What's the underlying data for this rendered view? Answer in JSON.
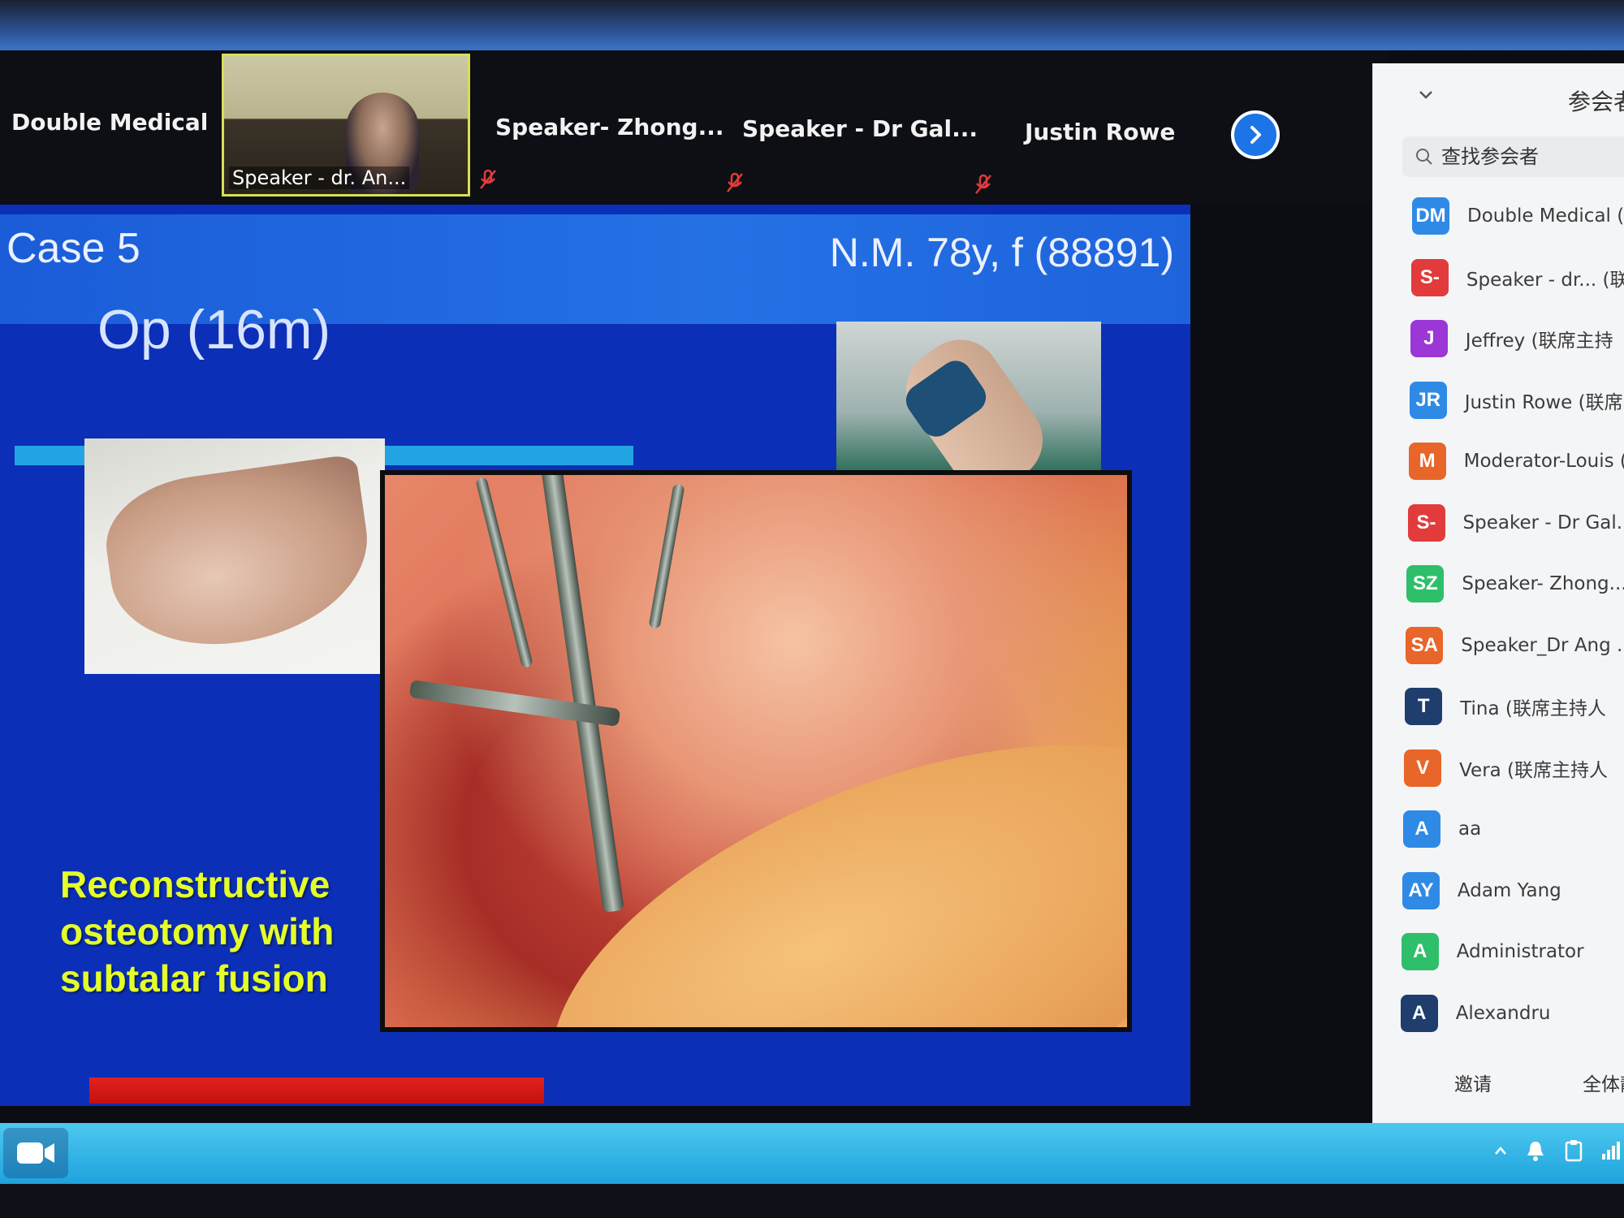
{
  "thumbnails": {
    "tiles": [
      {
        "label": "Double Medical"
      },
      {
        "label": "Speaker - dr. An..."
      },
      {
        "label": "Speaker-  Zhong..."
      },
      {
        "label": "Speaker  -  Dr Gal..."
      },
      {
        "label": "Justin Rowe"
      }
    ]
  },
  "slide": {
    "case_title": "Case 5",
    "patient_id": "N.M. 78y, f (88891)",
    "op_title": "Op (16m)",
    "caption_lines": [
      "Reconstructive",
      "osteotomy with",
      "subtalar fusion"
    ]
  },
  "panel": {
    "title": "参会者",
    "search_placeholder": "查找参会者",
    "participants": [
      {
        "initials": "DM",
        "name": "Double Medical (",
        "color": "#2f8ae6"
      },
      {
        "initials": "S-",
        "name": "Speaker - dr... (联",
        "color": "#e23b3b"
      },
      {
        "initials": "J",
        "name": "Jeffrey (联席主持",
        "color": "#9b37d6"
      },
      {
        "initials": "JR",
        "name": "Justin Rowe (联席",
        "color": "#2f8ae6"
      },
      {
        "initials": "M",
        "name": "Moderator-Louis (",
        "color": "#e8662a"
      },
      {
        "initials": "S-",
        "name": "Speaker - Dr Gal...",
        "color": "#e23b3b"
      },
      {
        "initials": "SZ",
        "name": "Speaker- Zhong...",
        "color": "#2fbf6a"
      },
      {
        "initials": "SA",
        "name": "Speaker_Dr Ang ...",
        "color": "#e8662a"
      },
      {
        "initials": "T",
        "name": "Tina (联席主持人",
        "color": "#1f3e6e"
      },
      {
        "initials": "V",
        "name": "Vera (联席主持人",
        "color": "#e8662a"
      },
      {
        "initials": "A",
        "name": "aa",
        "color": "#2f8ae6"
      },
      {
        "initials": "AY",
        "name": "Adam Yang",
        "color": "#2f8ae6"
      },
      {
        "initials": "A",
        "name": "Administrator",
        "color": "#2fbf6a"
      },
      {
        "initials": "A",
        "name": "Alexandru",
        "color": "#1f3e6e"
      }
    ],
    "footer": {
      "invite": "邀请",
      "mute_all": "全体静"
    }
  },
  "colors": {
    "slide_bg": "#0c2fb8",
    "caption": "#e4ff2a",
    "accent_blue": "#1d74e6"
  }
}
